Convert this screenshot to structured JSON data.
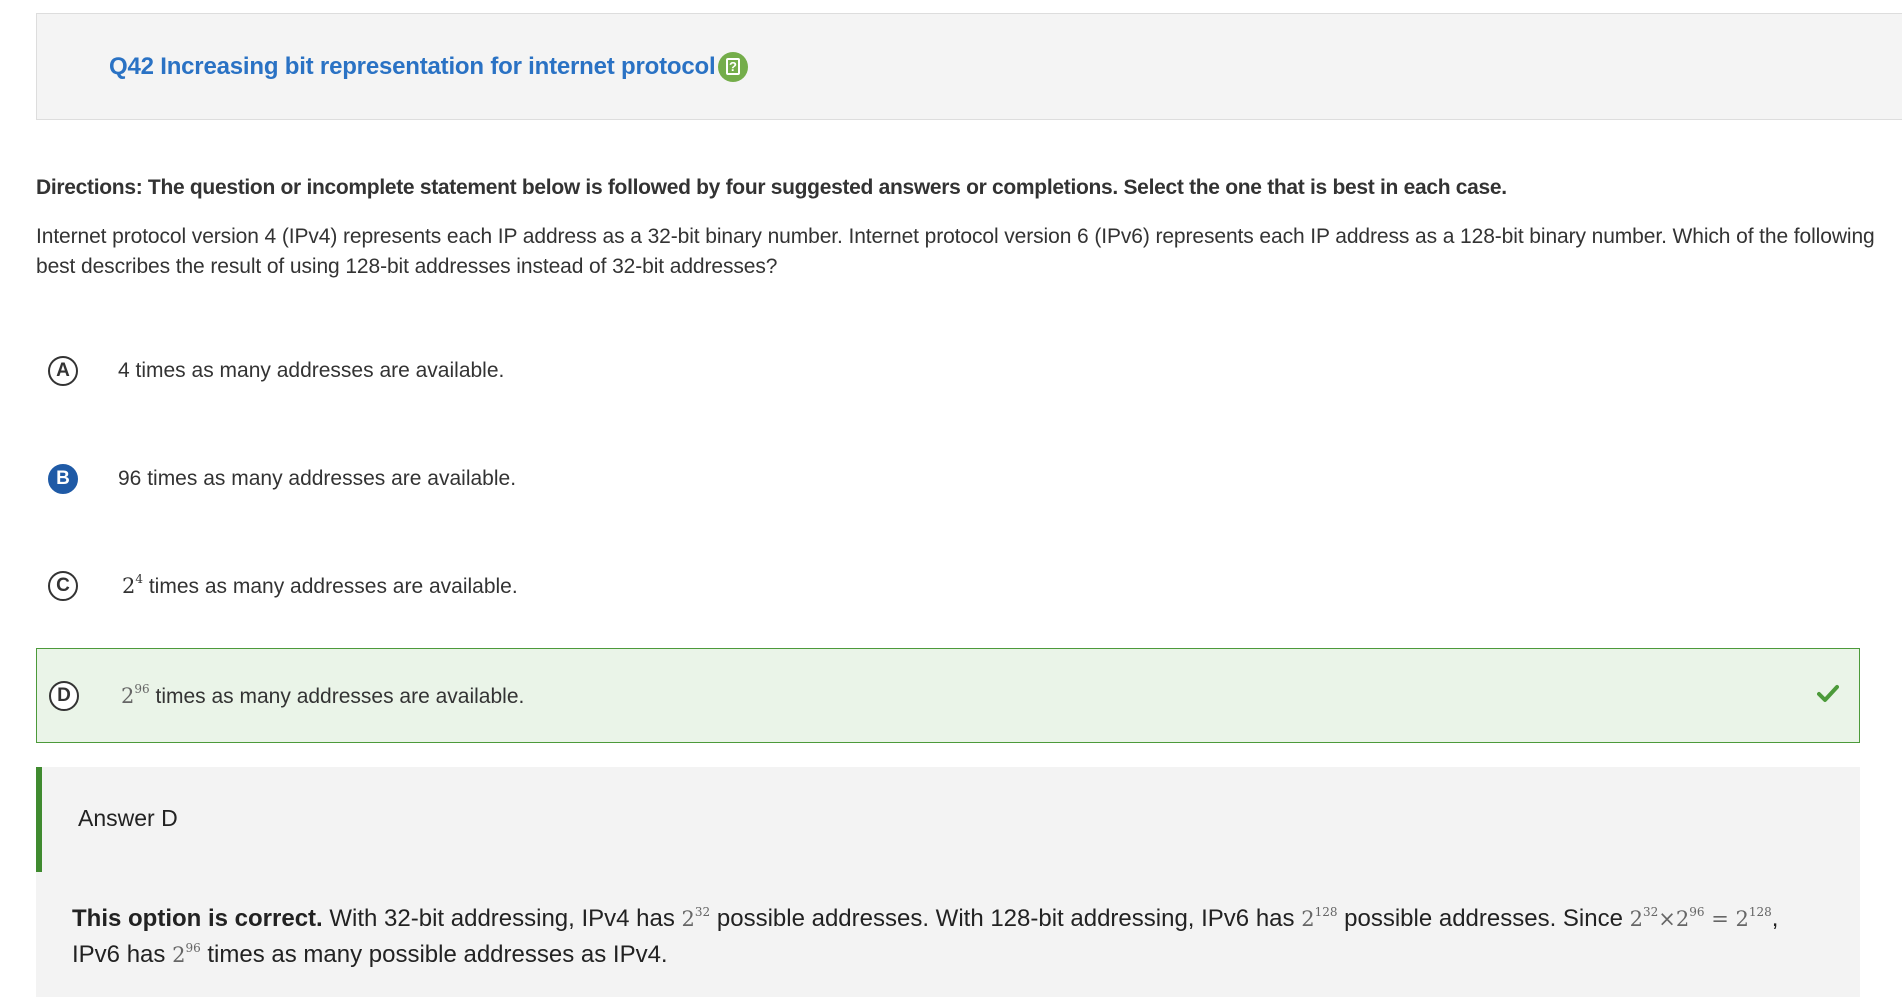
{
  "header": {
    "title": "Q42 Increasing bit representation for internet protocol",
    "help_icon": "question-mark-icon"
  },
  "directions": "Directions: The question or incomplete statement below is followed by four suggested answers or completions. Select the one that is best in each case.",
  "question": "Internet protocol version 4 (IPv4) represents each IP address as a 32-bit binary number. Internet protocol version 6 (IPv6) represents each IP address as a 128-bit binary number. Which of the following best describes the result of using 128-bit addresses instead of 32-bit addresses?",
  "options": [
    {
      "letter": "A",
      "text": "4 times as many addresses are available.",
      "state": "unselected"
    },
    {
      "letter": "B",
      "text": "96 times as many addresses are available.",
      "state": "selected"
    },
    {
      "letter": "C",
      "base": "2",
      "exp": "4",
      "text": " times as many addresses are available.",
      "state": "unselected"
    },
    {
      "letter": "D",
      "base": "2",
      "exp": "96",
      "text": " times as many addresses are available.",
      "state": "correct",
      "icon": "checkmark-icon"
    }
  ],
  "answer": {
    "title": "Answer D",
    "lead": "This option is correct.",
    "part1": " With 32-bit addressing, IPv4 has ",
    "m1_base": "2",
    "m1_exp": "32",
    "part2": " possible addresses. With 128-bit addressing, IPv6 has ",
    "m2_base": "2",
    "m2_exp": "128",
    "part3": " possible addresses. Since ",
    "m3_a_base": "2",
    "m3_a_exp": "32",
    "m3_op": "×",
    "m3_b_base": "2",
    "m3_b_exp": "96",
    "m3_eq": " = ",
    "m3_c_base": "2",
    "m3_c_exp": "128",
    "part4": ", IPv6 has ",
    "m4_base": "2",
    "m4_exp": "96",
    "part5": " times as many possible addresses as IPv4."
  },
  "colors": {
    "title_blue": "#2a72c4",
    "correct_green": "#4c9a3a",
    "selected_blue": "#1f5aa6",
    "help_green": "#74ad4a"
  }
}
